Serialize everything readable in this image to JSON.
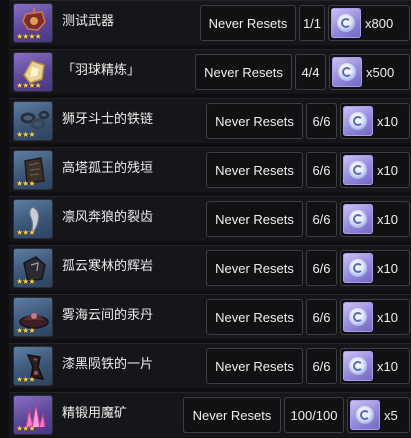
{
  "items": [
    {
      "name": "测试武器",
      "reset": "Never Resets",
      "limit": "1/1",
      "cost": "x800",
      "stars": "★★★★",
      "icon": "ornate-weapon-icon",
      "frame": "purple"
    },
    {
      "name": "「羽球精炼」",
      "reset": "Never Resets",
      "limit": "4/4",
      "cost": "x500",
      "stars": "★★★★",
      "icon": "golden-refinement-icon",
      "frame": "purple"
    },
    {
      "name": "狮牙斗士的铁链",
      "reset": "Never Resets",
      "limit": "6/6",
      "cost": "x10",
      "stars": "★★★",
      "icon": "iron-chain-icon",
      "frame": "blue"
    },
    {
      "name": "高塔孤王的残垣",
      "reset": "Never Resets",
      "limit": "6/6",
      "cost": "x10",
      "stars": "★★★",
      "icon": "broken-tablet-icon",
      "frame": "blue"
    },
    {
      "name": "凛风奔狼的裂齿",
      "reset": "Never Resets",
      "limit": "6/6",
      "cost": "x10",
      "stars": "★★★",
      "icon": "wolf-tooth-icon",
      "frame": "blue"
    },
    {
      "name": "孤云寒林的辉岩",
      "reset": "Never Resets",
      "limit": "6/6",
      "cost": "x10",
      "stars": "★★★",
      "icon": "glowing-rock-icon",
      "frame": "blue"
    },
    {
      "name": "雾海云间的汞丹",
      "reset": "Never Resets",
      "limit": "6/6",
      "cost": "x10",
      "stars": "★★★",
      "icon": "mercury-pill-icon",
      "frame": "blue"
    },
    {
      "name": "漆黑陨铁的一片",
      "reset": "Never Resets",
      "limit": "6/6",
      "cost": "x10",
      "stars": "★★★",
      "icon": "meteorite-shard-icon",
      "frame": "blue"
    },
    {
      "name": "精锻用魔矿",
      "reset": "Never Resets",
      "limit": "100/100",
      "cost": "x5",
      "stars": "★★★",
      "icon": "crystal-ore-icon",
      "frame": "purple"
    }
  ],
  "currency_icon": "starglitter-gem-icon",
  "colors": {
    "star": "#ffd24a",
    "box_border": "#3e3e46",
    "gem": "#8f86d8"
  }
}
